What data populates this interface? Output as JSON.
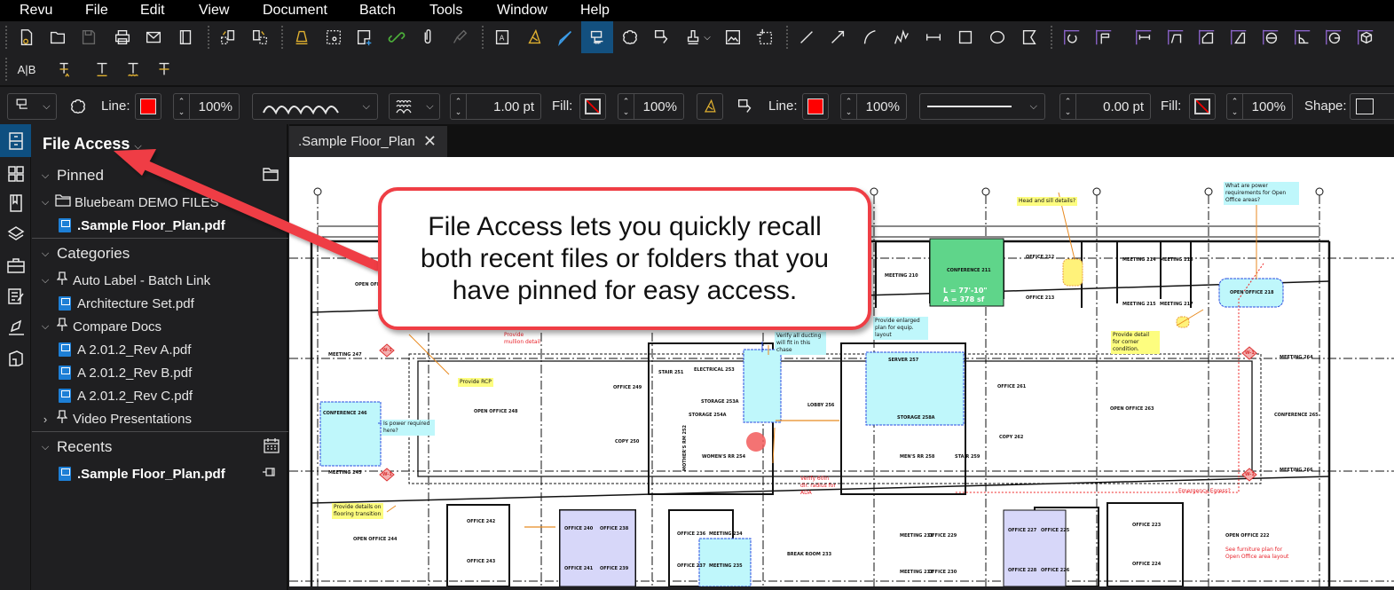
{
  "menu": [
    "Revu",
    "File",
    "Edit",
    "View",
    "Document",
    "Batch",
    "Tools",
    "Window",
    "Help"
  ],
  "toolbar_row1": {
    "file_tools": [
      "new-document",
      "open",
      "save",
      "print",
      "email",
      "notebook"
    ],
    "page_tools": [
      "extract-pages",
      "insert-pages"
    ],
    "markup_tools": [
      "stamp-bell",
      "snapshot",
      "add-space",
      "link",
      "attachment",
      "format-painter"
    ],
    "annotation_tools": [
      "text-box",
      "highlight-measure",
      "pen",
      "cloud-callout",
      "cloud",
      "arrow-callout",
      "stamp",
      "image",
      "crop-region"
    ],
    "shape_tools": [
      "line",
      "arrow",
      "arc",
      "polyline",
      "dimension",
      "rectangle",
      "ellipse",
      "polygon"
    ],
    "measure_tools": [
      "calibrate",
      "measure-flag",
      "length",
      "polylength",
      "area",
      "perimeter",
      "diameter",
      "angle",
      "radius",
      "volume"
    ]
  },
  "toolbar_row2": {
    "text_tools": [
      "replace-text",
      "insert-text",
      "underline",
      "squiggly",
      "strikethrough"
    ]
  },
  "properties_bar": {
    "line_label": "Line:",
    "line_color": "#ff0000",
    "line_opacity": "100%",
    "line_width": "1.00 pt",
    "fill_label": "Fill:",
    "fill_opacity": "100%",
    "line_label_2": "Line:",
    "line_color_2": "#ff0000",
    "line_opacity_2": "100%",
    "line_width_2": "0.00 pt",
    "fill_label_2": "Fill:",
    "fill_opacity_2": "100%",
    "shape_label": "Shape:"
  },
  "rail": [
    "file-access",
    "thumbnails",
    "bookmarks",
    "layers",
    "toolchest",
    "markups-list",
    "signatures",
    "spaces"
  ],
  "panel": {
    "title": "File Access",
    "pinned": {
      "label": "Pinned",
      "folder": "Bluebeam DEMO FILES",
      "files": [
        ".Sample Floor_Plan.pdf"
      ]
    },
    "categories": {
      "label": "Categories",
      "groups": [
        {
          "name": "Auto Label - Batch Link",
          "expanded": true,
          "files": [
            "Architecture Set.pdf"
          ]
        },
        {
          "name": "Compare Docs",
          "expanded": true,
          "files": [
            "A 2.01.2_Rev A.pdf",
            "A 2.01.2_Rev B.pdf",
            "A 2.01.2_Rev C.pdf"
          ]
        },
        {
          "name": "Video Presentations",
          "expanded": false,
          "files": []
        }
      ]
    },
    "recents": {
      "label": "Recents",
      "files": [
        ".Sample Floor_Plan.pdf"
      ]
    }
  },
  "document_tab": {
    "title": ".Sample Floor_Plan"
  },
  "callout": {
    "text": "File Access lets you quickly recall both recent files or folders that you have pinned for easy access."
  },
  "floor_plan": {
    "rooms": [
      "OPEN OFFICE",
      "MEETING 210",
      "CONFERENCE 211",
      "OFFICE 212",
      "OFFICE 213",
      "MEETING 214",
      "MEETING 216",
      "MEETING 215",
      "MEETING 217",
      "OPEN OFFICE 218",
      "MEETING 247",
      "CONFERENCE 246",
      "MEETING 245",
      "OPEN OFFICE 248",
      "OFFICE 249",
      "COPY 250",
      "STAIR 251",
      "ELECTRICAL 253",
      "STORAGE 253A",
      "STORAGE 254A",
      "MOTHER'S RM 252",
      "WOMEN'S RR 254",
      "LOBBY 256",
      "SERVER 257",
      "STORAGE 258A",
      "MEN'S RR 258",
      "STAIR 259",
      "OFFICE 261",
      "COPY 262",
      "OPEN OFFICE 263",
      "MEETING 264",
      "CONFERENCE 265",
      "MEETING 266",
      "OPEN OFFICE 244",
      "OFFICE 242",
      "OFFICE 243",
      "OFFICE 240",
      "OFFICE 238",
      "OFFICE 241",
      "OFFICE 239",
      "OFFICE 236",
      "MEETING 234",
      "OFFICE 237",
      "MEETING 235",
      "BREAK ROOM 233",
      "MEETING 231",
      "OFFICE 229",
      "MEETING 232",
      "OFFICE 230",
      "OFFICE 227",
      "OFFICE 225",
      "OFFICE 228",
      "OFFICE 226",
      "OFFICE 223",
      "OFFICE 224",
      "OPEN OFFICE 222"
    ],
    "measurement": {
      "length": "L = 77'-10\"",
      "area": "A = 378 sf"
    },
    "notes": {
      "head_sill": "Head and sill details?",
      "power_open_office": "What are power requirements for Open Office areas?",
      "enlarged_plan": "Provide enlarged plan for equip. layout",
      "corner": "Provide detail for corner condition.",
      "mullion": "Provide mullion detail",
      "rcp": "Provide RCP",
      "power_here": "Is power required here?",
      "ducting": "Verify all ducting will fit in this chase",
      "ada": "Verify 60in dir. radius for ADA",
      "egress": "Emergency Egress?",
      "flooring": "Provide details on flooring transition",
      "furniture": "See furniture plan for Open Office area layout"
    },
    "tags": [
      "W-1",
      "W-1",
      "W-1",
      "W-1"
    ]
  }
}
